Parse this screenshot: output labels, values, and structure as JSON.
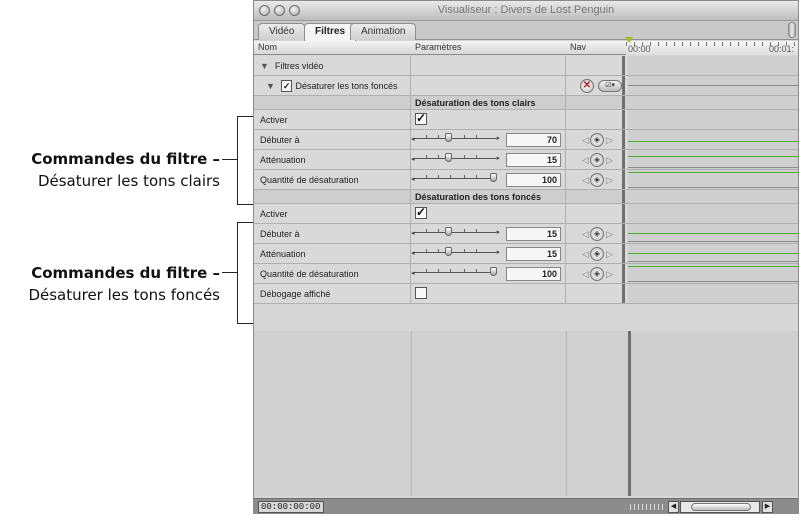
{
  "callouts": [
    {
      "title": "Commandes du filtre –",
      "subtitle": "Désaturer les tons clairs"
    },
    {
      "title": "Commandes du filtre –",
      "subtitle": "Désaturer les tons foncés"
    }
  ],
  "window": {
    "title": "Visualiseur : Divers de Lost Penguin"
  },
  "tabs": [
    "Vidéo",
    "Filtres",
    "Animation"
  ],
  "active_tab": "Filtres",
  "columns": {
    "name": "Nom",
    "params": "Paramètres",
    "nav": "Nav"
  },
  "ruler": {
    "start": "00:00",
    "end": "00:01:"
  },
  "rows": {
    "video_filters": "Filtres vidéo",
    "filter_name": "Désaturer les tons foncés",
    "group1": "Désaturation des tons clairs",
    "g1_enable": "Activer",
    "g1_start": {
      "label": "Débuter à",
      "value": "70"
    },
    "g1_soft": {
      "label": "Atténuation",
      "value": "15"
    },
    "g1_amount": {
      "label": "Quantité de désaturation",
      "value": "100"
    },
    "group2": "Désaturation des tons foncés",
    "g2_enable": "Activer",
    "g2_start": {
      "label": "Débuter à",
      "value": "15"
    },
    "g2_soft": {
      "label": "Atténuation",
      "value": "15"
    },
    "g2_amount": {
      "label": "Quantité de désaturation",
      "value": "100"
    },
    "debug": "Débogage affiché"
  },
  "timecode": "00:00:00:00",
  "colors": {
    "curve": "#4caf2e",
    "playhead": "#9ac21f",
    "reset": "#b01e1e"
  }
}
